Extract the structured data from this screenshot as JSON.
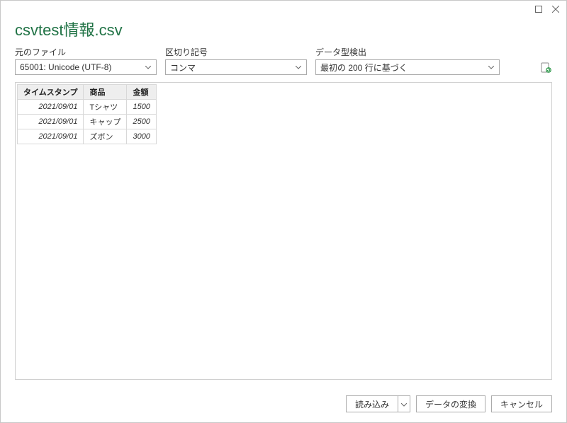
{
  "window": {
    "title": "csvtest情報.csv"
  },
  "labels": {
    "file_origin": "元のファイル",
    "delimiter": "区切り記号",
    "data_type_detection": "データ型検出"
  },
  "dropdowns": {
    "file_origin_value": "65001: Unicode (UTF-8)",
    "delimiter_value": "コンマ",
    "detection_value": "最初の 200 行に基づく"
  },
  "table": {
    "columns": [
      "タイムスタンプ",
      "商品",
      "金額"
    ],
    "rows": [
      {
        "timestamp": "2021/09/01",
        "product": "Tシャツ",
        "amount": "1500"
      },
      {
        "timestamp": "2021/09/01",
        "product": "キャップ",
        "amount": "2500"
      },
      {
        "timestamp": "2021/09/01",
        "product": "ズボン",
        "amount": "3000"
      }
    ]
  },
  "buttons": {
    "load": "読み込み",
    "transform": "データの変換",
    "cancel": "キャンセル"
  }
}
